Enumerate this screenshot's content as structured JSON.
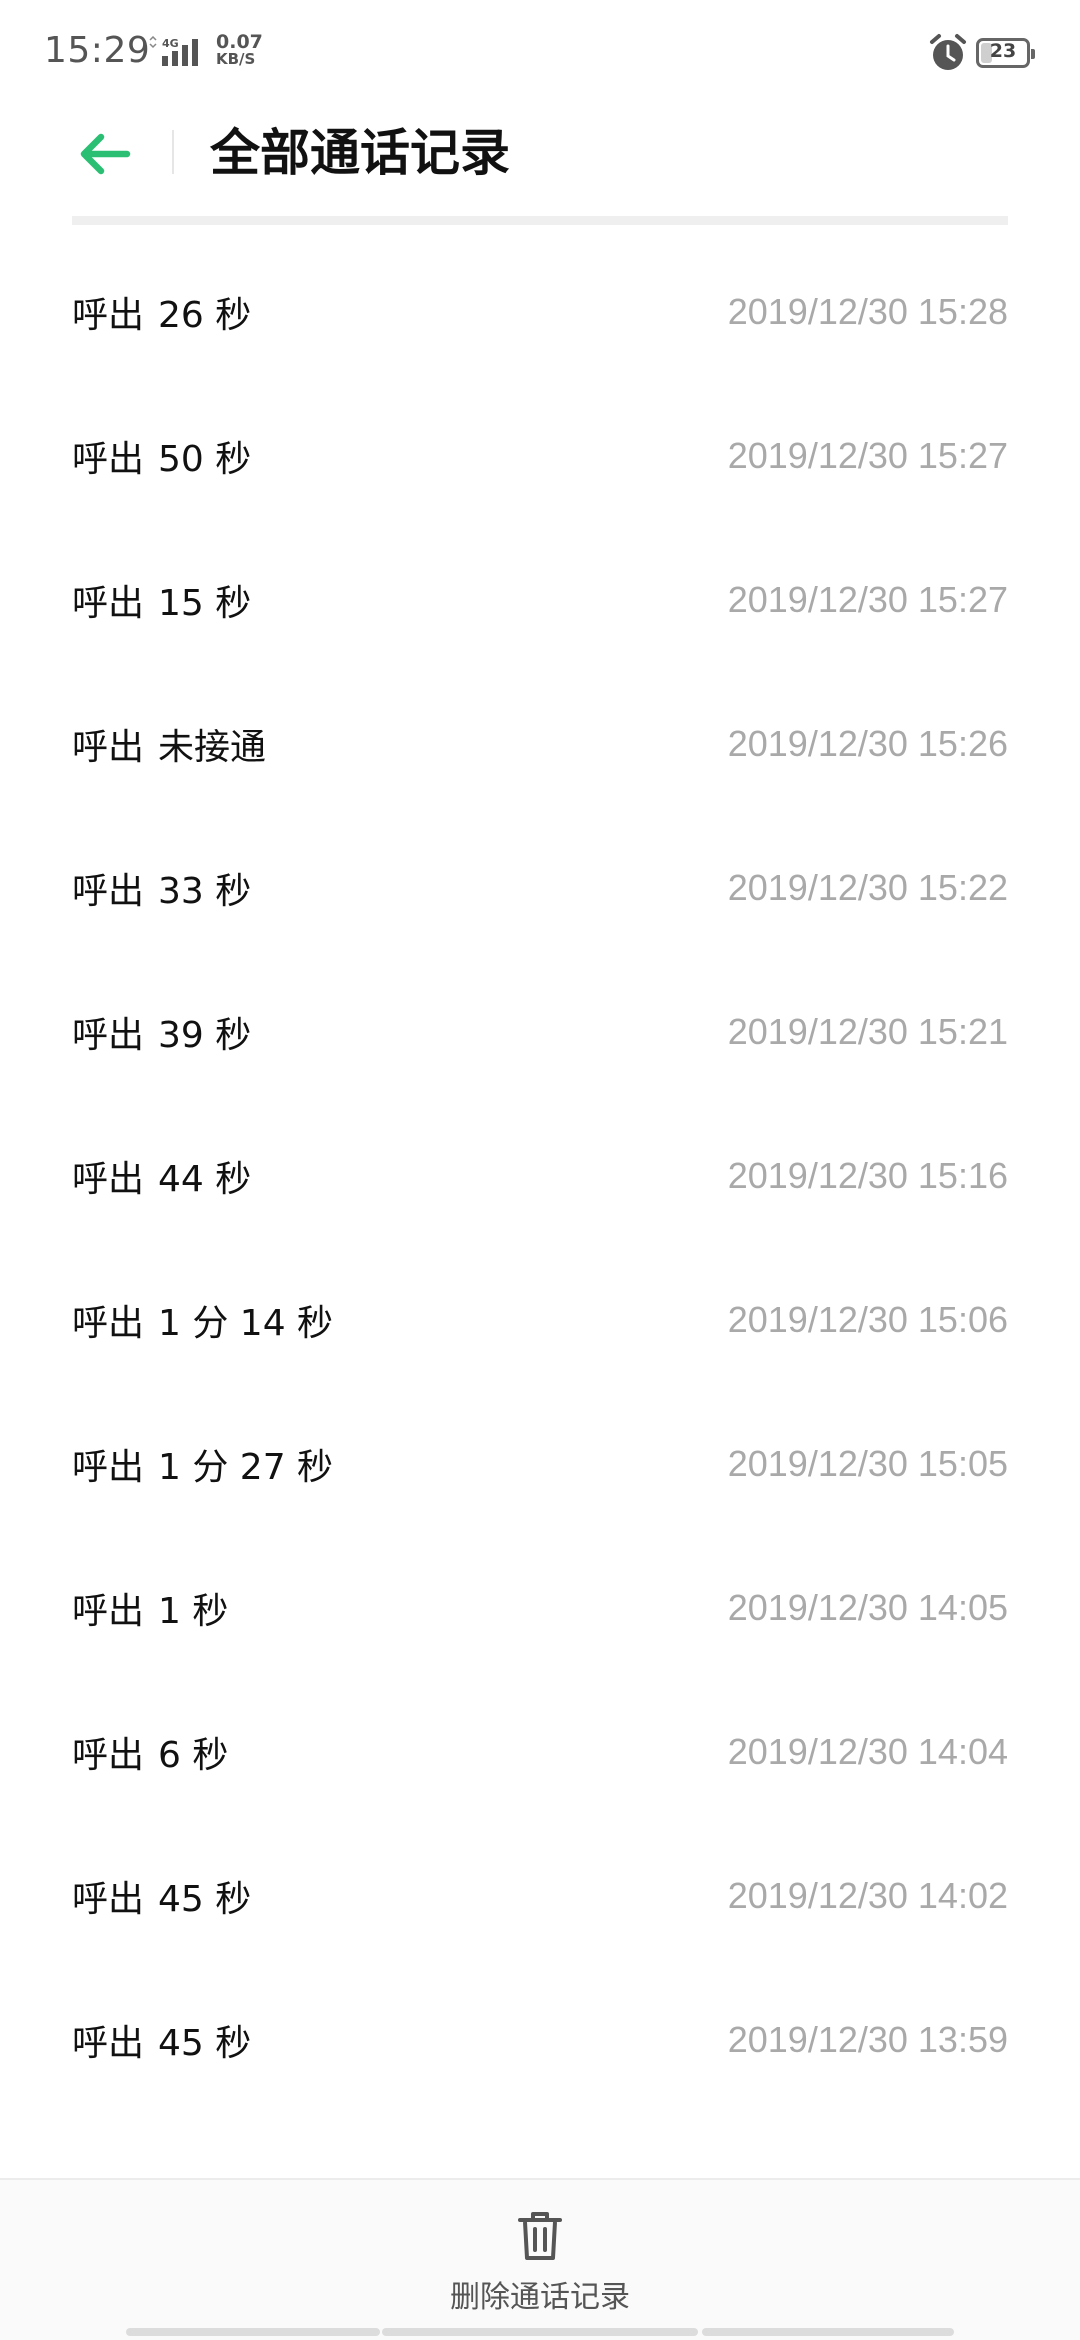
{
  "status_bar": {
    "time": "15:29",
    "network_type": "4G",
    "speed_value": "0.07",
    "speed_unit": "KB/S",
    "battery_level": "23"
  },
  "header": {
    "title": "全部通话记录"
  },
  "calls": [
    {
      "type": "呼出",
      "duration": "26 秒",
      "time": "2019/12/30 15:28"
    },
    {
      "type": "呼出",
      "duration": "50 秒",
      "time": "2019/12/30 15:27"
    },
    {
      "type": "呼出",
      "duration": "15 秒",
      "time": "2019/12/30 15:27"
    },
    {
      "type": "呼出",
      "duration": "未接通",
      "time": "2019/12/30 15:26"
    },
    {
      "type": "呼出",
      "duration": "33 秒",
      "time": "2019/12/30 15:22"
    },
    {
      "type": "呼出",
      "duration": "39 秒",
      "time": "2019/12/30 15:21"
    },
    {
      "type": "呼出",
      "duration": "44 秒",
      "time": "2019/12/30 15:16"
    },
    {
      "type": "呼出",
      "duration": "1 分 14 秒",
      "time": "2019/12/30 15:06"
    },
    {
      "type": "呼出",
      "duration": "1 分 27 秒",
      "time": "2019/12/30 15:05"
    },
    {
      "type": "呼出",
      "duration": "1 秒",
      "time": "2019/12/30 14:05"
    },
    {
      "type": "呼出",
      "duration": "6 秒",
      "time": "2019/12/30 14:04"
    },
    {
      "type": "呼出",
      "duration": "45 秒",
      "time": "2019/12/30 14:02"
    },
    {
      "type": "呼出",
      "duration": "45 秒",
      "time": "2019/12/30 13:59"
    }
  ],
  "toolbar": {
    "delete_label": "删除通话记录"
  },
  "icons": {
    "back": "arrow-left-icon",
    "delete": "trash-icon",
    "alarm": "alarm-clock-icon"
  },
  "colors": {
    "accent": "#2bbf74",
    "secondary_text": "#a9a9a9"
  }
}
